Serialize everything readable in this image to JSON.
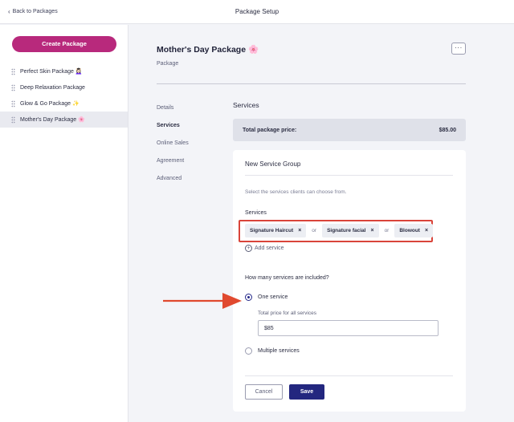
{
  "header": {
    "back_label": "Back to Packages",
    "title": "Package Setup"
  },
  "sidebar": {
    "create_label": "Create Package",
    "items": [
      {
        "label": "Perfect Skin Package 💆🏻‍♀️"
      },
      {
        "label": "Deep Relaxation Package"
      },
      {
        "label": "Glow & Go Package ✨"
      },
      {
        "label": "Mother's Day Package 🌸"
      }
    ]
  },
  "package": {
    "title": "Mother's Day Package 🌸",
    "subtitle": "Package",
    "more_label": "···"
  },
  "nav": {
    "items": [
      {
        "label": "Details"
      },
      {
        "label": "Services"
      },
      {
        "label": "Online Sales"
      },
      {
        "label": "Agreement"
      },
      {
        "label": "Advanced"
      }
    ]
  },
  "services": {
    "section_title": "Services",
    "total_label": "Total package price:",
    "total_value": "$85.00",
    "card_title": "New Service Group",
    "hint": "Select the services clients can choose from.",
    "services_label": "Services",
    "chips": [
      {
        "label": "Signature Haircut"
      },
      {
        "label": "Signature facial"
      },
      {
        "label": "Blowout"
      }
    ],
    "or_text": "or",
    "remove_glyph": "×",
    "add_label": "Add service",
    "question": "How many services are included?",
    "option_one": "One service",
    "price_label": "Total price for all services",
    "price_value": "$85",
    "option_multiple": "Multiple services",
    "cancel_label": "Cancel",
    "save_label": "Save"
  },
  "colors": {
    "brand": "#b8297c",
    "primary": "#23277f",
    "highlight": "#d9443a"
  },
  "icons": {
    "back": "chevron-left-icon",
    "drag": "drag-handle-icon",
    "add": "plus-circle-icon",
    "remove": "close-icon",
    "annotation": "arrow-right-icon"
  }
}
